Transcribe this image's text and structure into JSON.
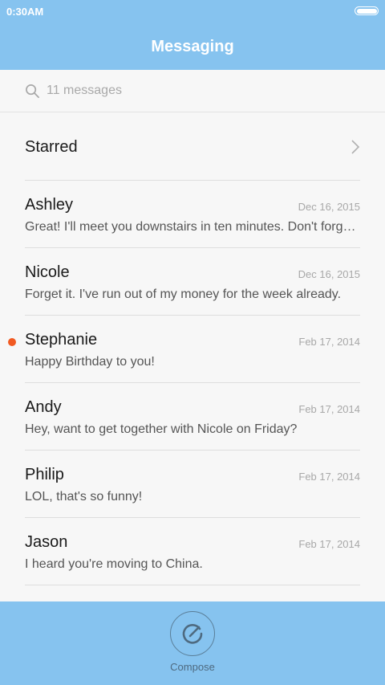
{
  "status_bar": {
    "time": "0:30AM"
  },
  "header": {
    "title": "Messaging"
  },
  "search": {
    "placeholder": "11 messages"
  },
  "starred": {
    "label": "Starred"
  },
  "messages": [
    {
      "name": "Ashley",
      "date": "Dec 16, 2015",
      "preview": "Great! I'll meet you downstairs in ten minutes. Don't forget your umbrella.",
      "unread": false
    },
    {
      "name": "Nicole",
      "date": "Dec 16, 2015",
      "preview": "Forget it. I've run out of my money for the week already.",
      "unread": false
    },
    {
      "name": "Stephanie",
      "date": "Feb 17, 2014",
      "preview": "Happy Birthday to you!",
      "unread": true
    },
    {
      "name": "Andy",
      "date": "Feb 17, 2014",
      "preview": "Hey, want to get together with Nicole on Friday?",
      "unread": false
    },
    {
      "name": "Philip",
      "date": "Feb 17, 2014",
      "preview": "LOL, that's so funny!",
      "unread": false
    },
    {
      "name": "Jason",
      "date": "Feb 17, 2014",
      "preview": "I heard you're moving to China.",
      "unread": false
    }
  ],
  "bottom_bar": {
    "compose_label": "Compose"
  },
  "colors": {
    "bar": "#86c3ef",
    "unread_dot": "#f15a22",
    "background": "#f7f7f7"
  },
  "icons": {
    "search": "search-icon",
    "chevron": "chevron-right-icon",
    "compose": "compose-icon",
    "battery": "battery-icon"
  }
}
